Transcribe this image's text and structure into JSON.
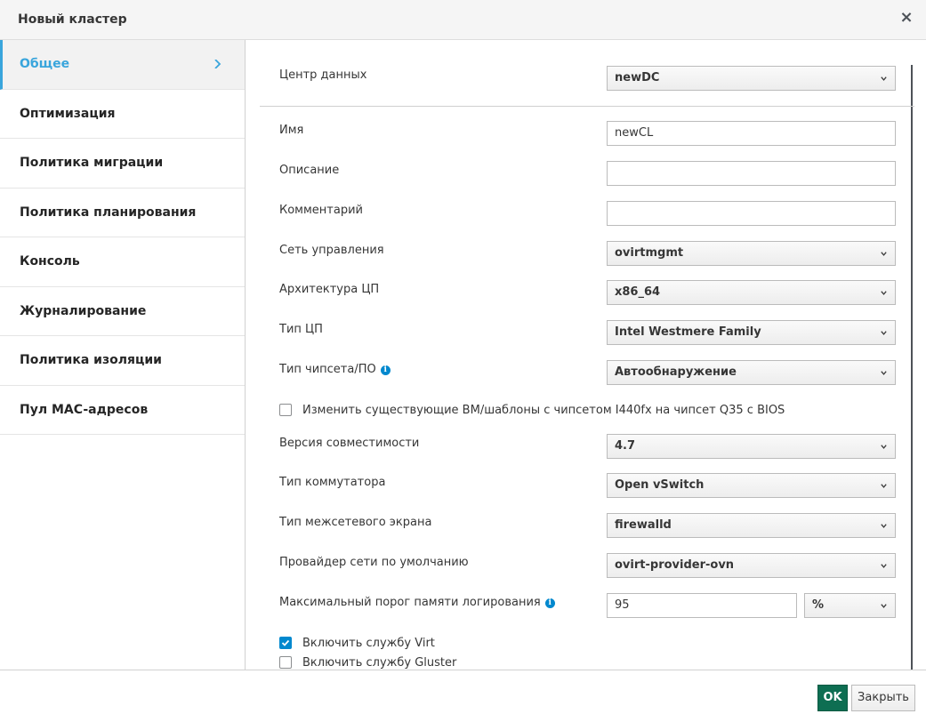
{
  "dialog": {
    "title": "Новый кластер",
    "close_glyph": "×"
  },
  "sidebar": {
    "items": [
      {
        "label": "Общее",
        "active": true
      },
      {
        "label": "Оптимизация"
      },
      {
        "label": "Политика миграции"
      },
      {
        "label": "Политика планирования"
      },
      {
        "label": "Консоль"
      },
      {
        "label": "Журналирование"
      },
      {
        "label": "Политика изоляции"
      },
      {
        "label": "Пул MAC-адресов"
      }
    ]
  },
  "form": {
    "datacenter": {
      "label": "Центр данных",
      "value": "newDC"
    },
    "name": {
      "label": "Имя",
      "value": "newCL"
    },
    "description": {
      "label": "Описание",
      "value": ""
    },
    "comment": {
      "label": "Комментарий",
      "value": ""
    },
    "mgmt_network": {
      "label": "Сеть управления",
      "value": "ovirtmgmt"
    },
    "cpu_arch": {
      "label": "Архитектура ЦП",
      "value": "x86_64"
    },
    "cpu_type": {
      "label": "Тип ЦП",
      "value": "Intel Westmere Family"
    },
    "chipset": {
      "label": "Тип чипсета/ПО",
      "value": "Автообнаружение"
    },
    "change_vms": {
      "label": "Изменить существующие ВМ/шаблоны с чипсетом I440fx на чипсет Q35 с BIOS",
      "checked": false
    },
    "compat_version": {
      "label": "Версия совместимости",
      "value": "4.7"
    },
    "switch_type": {
      "label": "Тип коммутатора",
      "value": "Open vSwitch"
    },
    "firewall_type": {
      "label": "Тип межсетевого экрана",
      "value": "firewalld"
    },
    "network_provider": {
      "label": "Провайдер сети по умолчанию",
      "value": "ovirt-provider-ovn"
    },
    "log_threshold": {
      "label": "Максимальный порог памяти логирования",
      "value": "95",
      "unit": "%"
    },
    "virt_service": {
      "label": "Включить службу Virt",
      "checked": true
    },
    "gluster_service": {
      "label": "Включить службу Gluster",
      "checked": false
    }
  },
  "footer": {
    "ok_label": "OK",
    "close_label": "Закрыть"
  },
  "colors": {
    "accent": "#39a5dc",
    "ok_button": "#0e6e52",
    "checkbox_checked": "#0088ce"
  },
  "icons": {
    "info": "info-circle-icon",
    "caret": "chevron-down-icon",
    "nav_arrow": "chevron-right-icon"
  }
}
